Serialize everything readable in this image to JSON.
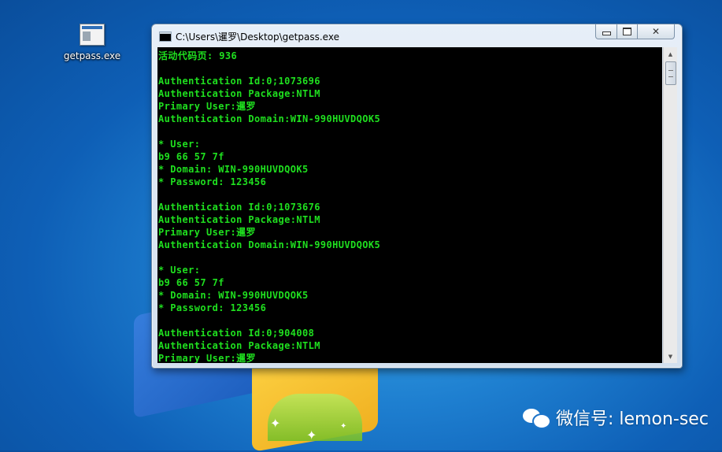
{
  "desktop": {
    "icon_label": "getpass.exe"
  },
  "window": {
    "title": "C:\\Users\\暹罗\\Desktop\\getpass.exe",
    "console_lines": [
      "活动代码页: 936",
      "",
      "Authentication Id:0;1073696",
      "Authentication Package:NTLM",
      "Primary User:暹罗",
      "Authentication Domain:WIN-990HUVDQOK5",
      "",
      "* User:",
      "b9 66 57 7f",
      "* Domain: WIN-990HUVDQOK5",
      "* Password: 123456",
      "",
      "Authentication Id:0;1073676",
      "Authentication Package:NTLM",
      "Primary User:暹罗",
      "Authentication Domain:WIN-990HUVDQOK5",
      "",
      "* User:",
      "b9 66 57 7f",
      "* Domain: WIN-990HUVDQOK5",
      "* Password: 123456",
      "",
      "Authentication Id:0;904008",
      "Authentication Package:NTLM",
      "Primary User:暹罗"
    ],
    "console_text_color": "#1fe01f",
    "console_bg_color": "#000000"
  },
  "watermark": {
    "text": "微信号: lemon-sec"
  }
}
